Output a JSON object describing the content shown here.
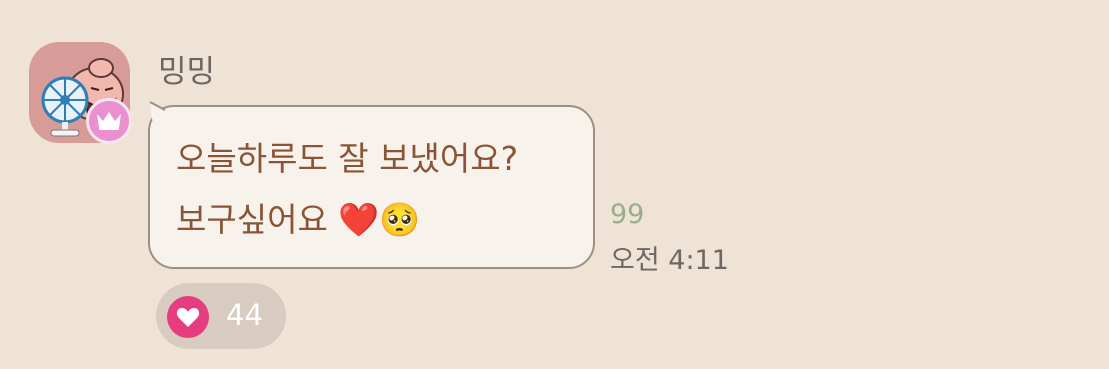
{
  "sender": {
    "name": "밍밍",
    "avatar_icon": "desk-fan-character-icon",
    "badge_icon": "crown-icon",
    "badge_color": "#ea8fcf"
  },
  "message": {
    "line1": "오늘하루도 잘 보냈어요?",
    "line2_text": "보구싶어요 ",
    "emoji_heart": "❤️",
    "emoji_face": "🥺",
    "read_count": "99",
    "time": "오전 4:11"
  },
  "reaction": {
    "icon": "heart-icon",
    "count": "44",
    "accent": "#e63c80"
  },
  "colors": {
    "background": "#efe3d5",
    "bubble": "#f8f2ec",
    "message_text": "#8a5436"
  }
}
